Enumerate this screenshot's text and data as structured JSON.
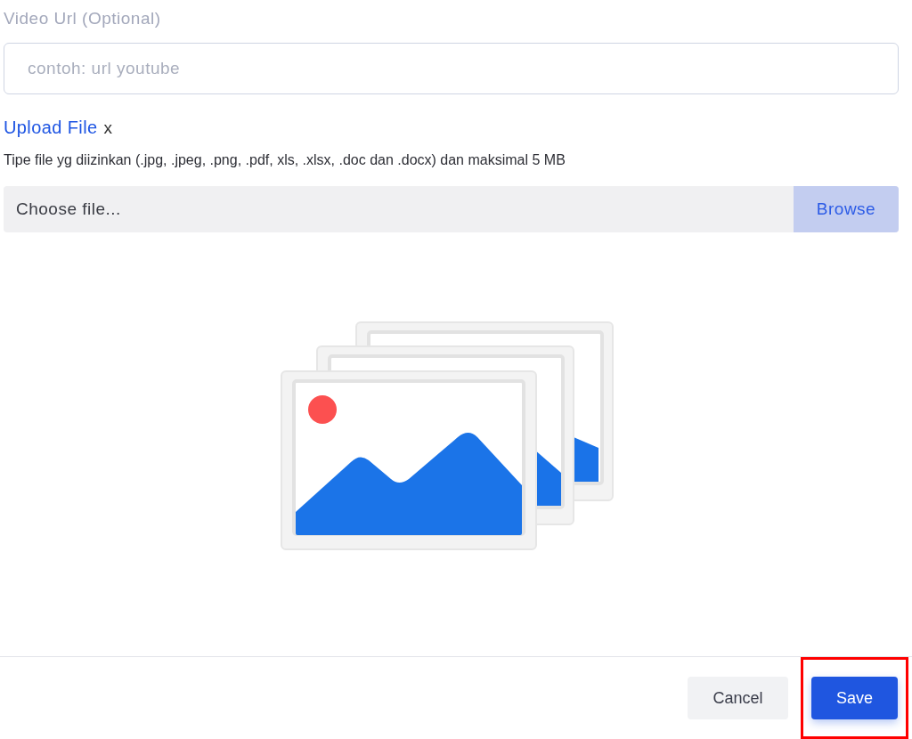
{
  "video_url": {
    "label": "Video Url (Optional)",
    "placeholder": "contoh: url youtube"
  },
  "upload": {
    "link": "Upload File",
    "remove": "x",
    "hint": "Tipe file yg diizinkan (.jpg, .jpeg, .png, .pdf, xls, .xlsx, .doc dan .docx) dan maksimal 5 MB",
    "placeholder": "Choose file...",
    "browse": "Browse"
  },
  "footer": {
    "buttons": [
      {
        "label": "Cancel",
        "kind": "secondary",
        "highlighted": false
      },
      {
        "label": "Save",
        "kind": "primary",
        "highlighted": true
      }
    ]
  }
}
